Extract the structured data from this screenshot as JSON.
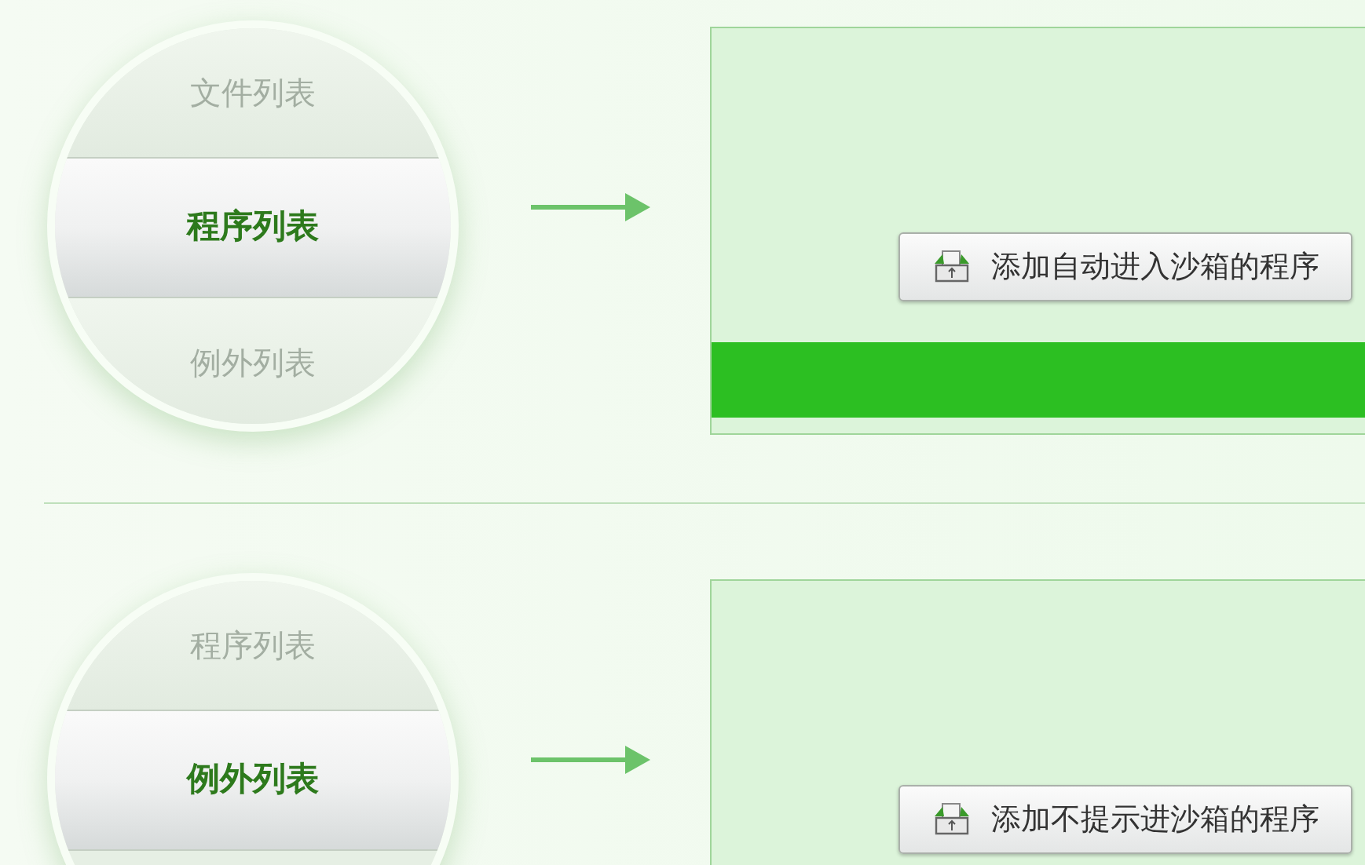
{
  "sections": [
    {
      "list_items": [
        {
          "label": "文件列表",
          "selected": false
        },
        {
          "label": "程序列表",
          "selected": true
        },
        {
          "label": "例外列表",
          "selected": false
        }
      ],
      "button": {
        "label": "添加自动进入沙箱的程序"
      },
      "footer_bar": true
    },
    {
      "list_items": [
        {
          "label": "程序列表",
          "selected": false
        },
        {
          "label": "例外列表",
          "selected": true
        }
      ],
      "button": {
        "label": "添加不提示进沙箱的程序"
      }
    }
  ]
}
